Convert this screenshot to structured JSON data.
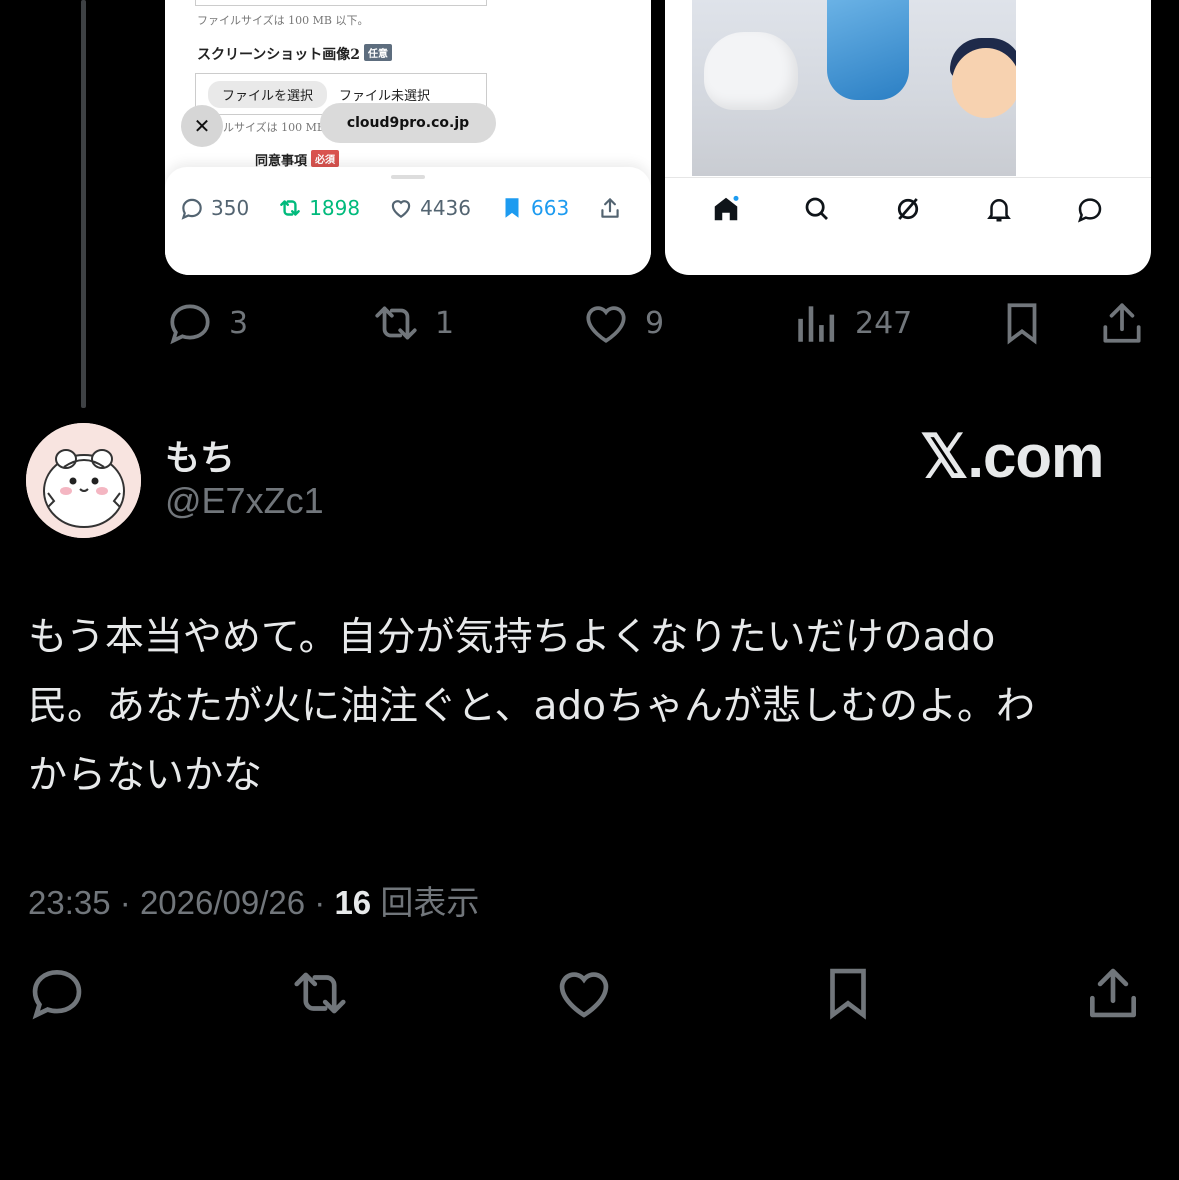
{
  "embedded_left": {
    "form_size_note_1": "ファイルサイズは 100 MB 以下。",
    "screenshot_label": "スクリーンショット画像2",
    "optional_tag": "任意",
    "file_button": "ファイルを選択",
    "file_status": "ファイル未選択",
    "form_size_note_2": "ァイルサイズは 100 MB",
    "consent_label": "同意事項",
    "required_tag": "必須",
    "close_icon": "close-icon",
    "url": "cloud9pro.co.jp",
    "stats": {
      "replies": "350",
      "reposts": "1898",
      "likes": "4436",
      "bookmarks": "663"
    },
    "colors": {
      "repost": "#00ba7c",
      "bookmark": "#1d9bf0",
      "neutral": "#536471"
    }
  },
  "embedded_right": {
    "nav_icons": [
      "home-icon",
      "search-icon",
      "grok-icon",
      "bell-icon",
      "message-icon"
    ]
  },
  "parent_actions": {
    "replies": "3",
    "reposts": "1",
    "likes": "9",
    "views": "247"
  },
  "reply": {
    "display_name": "もち",
    "handle": "@E7xZc1",
    "brand": "𝕏.com",
    "text_lines": [
      "もう本当やめて。自分が気持ちよくなりたいだけのado",
      "民。あなたが火に油注ぐと、adoちゃんが悲しむのよ。わ",
      "からないかな"
    ],
    "time": "23:35",
    "date": "2026/09/26",
    "views_count": "16",
    "views_label": "回表示"
  },
  "colors": {
    "background": "#000000",
    "text_primary": "#e7e9ea",
    "text_secondary": "#71767b",
    "thread_line": "#3e4144"
  }
}
